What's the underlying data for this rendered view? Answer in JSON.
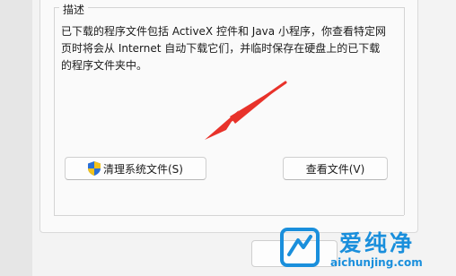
{
  "group": {
    "title": "描述"
  },
  "description": {
    "line1": "已下载的程序文件包括 ActiveX 控件和 Java 小程序，你查看特定网",
    "line2": "页时将会从 Internet 自动下载它们，并临时保存在硬盘上的已下载",
    "line3": "的程序文件夹中。"
  },
  "buttons": {
    "clean": "清理系统文件(S)",
    "view": "查看文件(V)"
  },
  "watermark": {
    "brand": "爱纯净",
    "url": "aichunjing.com"
  },
  "colors": {
    "arrow": "#e8322a",
    "brand": "#1a8fdc",
    "shield_blue": "#2a6fd6",
    "shield_yellow": "#f2c21b"
  },
  "icons": {
    "shield": "uac-shield-icon",
    "arrow": "red-annotation-arrow"
  }
}
